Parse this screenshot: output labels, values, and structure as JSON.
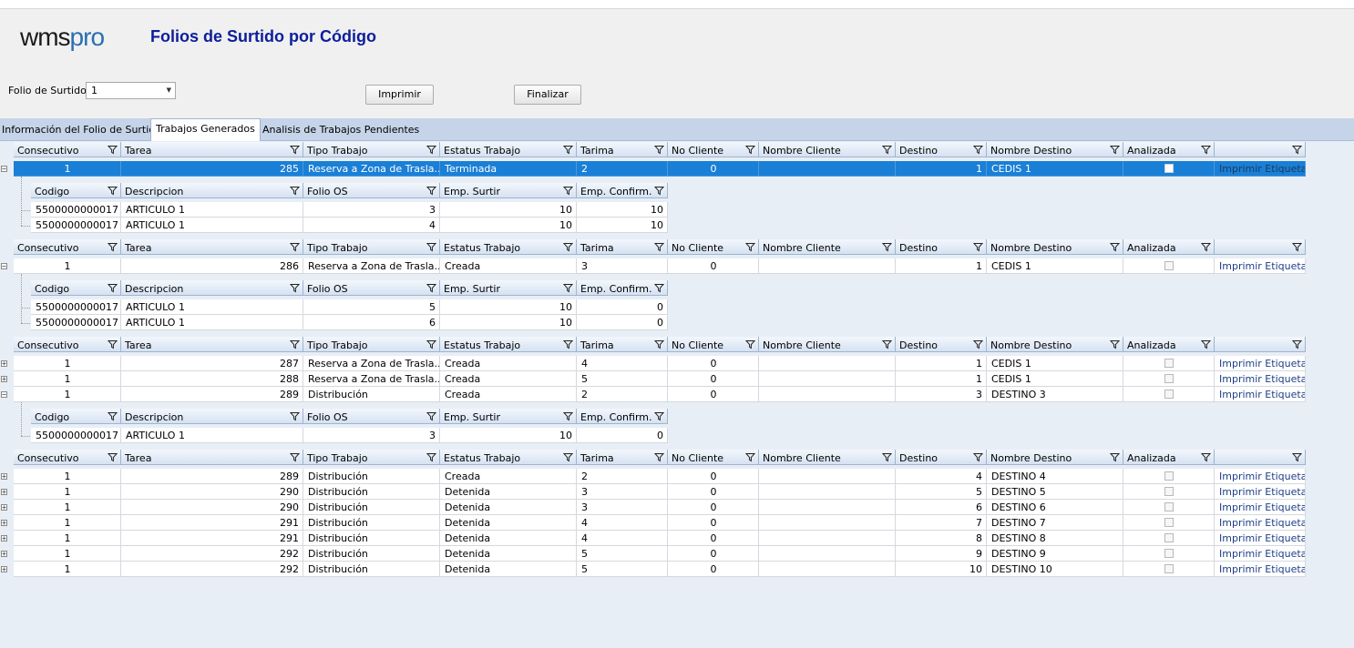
{
  "app": {
    "logo_wms": "wms",
    "logo_pro": "pro",
    "title": "Folios de Surtido por Código"
  },
  "form": {
    "folio_label": "Folio de Surtido",
    "folio_value": "1",
    "imprimir": "Imprimir",
    "finalizar": "Finalizar"
  },
  "tabs": [
    {
      "label": "Información del Folio de Surtido",
      "selected": false
    },
    {
      "label": "Trabajos Generados",
      "selected": true
    },
    {
      "label": "Analisis de Trabajos Pendientes",
      "selected": false
    }
  ],
  "main_columns": [
    "Consecutivo",
    "Tarea",
    "Tipo Trabajo",
    "Estatus Trabajo",
    "Tarima",
    "No Cliente",
    "Nombre Cliente",
    "Destino",
    "Nombre Destino",
    "Analizada",
    ""
  ],
  "detail_columns": [
    "Codigo",
    "Descripcion",
    "Folio OS",
    "Emp. Surtir",
    "Emp. Confirm."
  ],
  "action_label": "Imprimir Etiqueta",
  "groups": [
    {
      "rows": [
        {
          "consecutivo": "1",
          "tarea": "285",
          "tipo": "Reserva a Zona de Trasla...",
          "estatus": "Terminada",
          "tarima": "2",
          "no_cliente": "0",
          "nombre_cliente": "",
          "destino": "1",
          "nombre_destino": "CEDIS 1",
          "selected": true,
          "expanded": true,
          "details": [
            {
              "codigo": "5500000000017",
              "descripcion": "ARTICULO 1",
              "folio_os": "3",
              "emp_surtir": "10",
              "emp_confirm": "10"
            },
            {
              "codigo": "5500000000017",
              "descripcion": "ARTICULO 1",
              "folio_os": "4",
              "emp_surtir": "10",
              "emp_confirm": "10"
            }
          ]
        }
      ]
    },
    {
      "rows": [
        {
          "consecutivo": "1",
          "tarea": "286",
          "tipo": "Reserva a Zona de Trasla...",
          "estatus": "Creada",
          "tarima": "3",
          "no_cliente": "0",
          "nombre_cliente": "",
          "destino": "1",
          "nombre_destino": "CEDIS 1",
          "selected": false,
          "expanded": true,
          "details": [
            {
              "codigo": "5500000000017",
              "descripcion": "ARTICULO 1",
              "folio_os": "5",
              "emp_surtir": "10",
              "emp_confirm": "0"
            },
            {
              "codigo": "5500000000017",
              "descripcion": "ARTICULO 1",
              "folio_os": "6",
              "emp_surtir": "10",
              "emp_confirm": "0"
            }
          ]
        }
      ]
    },
    {
      "rows": [
        {
          "consecutivo": "1",
          "tarea": "287",
          "tipo": "Reserva a Zona de Trasla...",
          "estatus": "Creada",
          "tarima": "4",
          "no_cliente": "0",
          "nombre_cliente": "",
          "destino": "1",
          "nombre_destino": "CEDIS 1",
          "selected": false,
          "expanded": false
        },
        {
          "consecutivo": "1",
          "tarea": "288",
          "tipo": "Reserva a Zona de Trasla...",
          "estatus": "Creada",
          "tarima": "5",
          "no_cliente": "0",
          "nombre_cliente": "",
          "destino": "1",
          "nombre_destino": "CEDIS 1",
          "selected": false,
          "expanded": false
        },
        {
          "consecutivo": "1",
          "tarea": "289",
          "tipo": "Distribución",
          "estatus": "Creada",
          "tarima": "2",
          "no_cliente": "0",
          "nombre_cliente": "",
          "destino": "3",
          "nombre_destino": "DESTINO 3",
          "selected": false,
          "expanded": true,
          "details": [
            {
              "codigo": "5500000000017",
              "descripcion": "ARTICULO 1",
              "folio_os": "3",
              "emp_surtir": "10",
              "emp_confirm": "0"
            }
          ]
        }
      ]
    },
    {
      "rows": [
        {
          "consecutivo": "1",
          "tarea": "289",
          "tipo": "Distribución",
          "estatus": "Creada",
          "tarima": "2",
          "no_cliente": "0",
          "nombre_cliente": "",
          "destino": "4",
          "nombre_destino": "DESTINO 4",
          "selected": false,
          "expanded": false
        },
        {
          "consecutivo": "1",
          "tarea": "290",
          "tipo": "Distribución",
          "estatus": "Detenida",
          "tarima": "3",
          "no_cliente": "0",
          "nombre_cliente": "",
          "destino": "5",
          "nombre_destino": "DESTINO 5",
          "selected": false,
          "expanded": false
        },
        {
          "consecutivo": "1",
          "tarea": "290",
          "tipo": "Distribución",
          "estatus": "Detenida",
          "tarima": "3",
          "no_cliente": "0",
          "nombre_cliente": "",
          "destino": "6",
          "nombre_destino": "DESTINO 6",
          "selected": false,
          "expanded": false
        },
        {
          "consecutivo": "1",
          "tarea": "291",
          "tipo": "Distribución",
          "estatus": "Detenida",
          "tarima": "4",
          "no_cliente": "0",
          "nombre_cliente": "",
          "destino": "7",
          "nombre_destino": "DESTINO 7",
          "selected": false,
          "expanded": false
        },
        {
          "consecutivo": "1",
          "tarea": "291",
          "tipo": "Distribución",
          "estatus": "Detenida",
          "tarima": "4",
          "no_cliente": "0",
          "nombre_cliente": "",
          "destino": "8",
          "nombre_destino": "DESTINO 8",
          "selected": false,
          "expanded": false
        },
        {
          "consecutivo": "1",
          "tarea": "292",
          "tipo": "Distribución",
          "estatus": "Detenida",
          "tarima": "5",
          "no_cliente": "0",
          "nombre_cliente": "",
          "destino": "9",
          "nombre_destino": "DESTINO 9",
          "selected": false,
          "expanded": false
        },
        {
          "consecutivo": "1",
          "tarea": "292",
          "tipo": "Distribución",
          "estatus": "Detenida",
          "tarima": "5",
          "no_cliente": "0",
          "nombre_cliente": "",
          "destino": "10",
          "nombre_destino": "DESTINO 10",
          "selected": false,
          "expanded": false
        }
      ]
    }
  ]
}
